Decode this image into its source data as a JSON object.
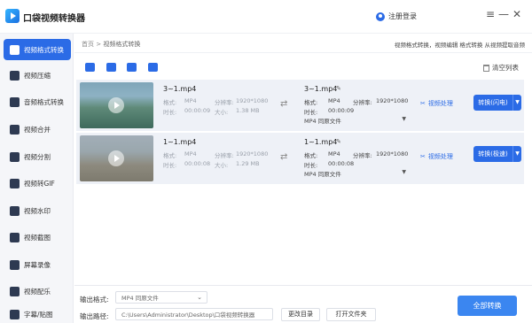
{
  "app": {
    "title": "口袋视频转换器",
    "login": "注册登录"
  },
  "window": {
    "menu_icon": "≡",
    "min_icon": "—",
    "close_icon": "✕"
  },
  "sidebar": {
    "items": [
      {
        "label": "视频格式转换",
        "icon": "format-convert-icon"
      },
      {
        "label": "视频压缩",
        "icon": "compress-icon"
      },
      {
        "label": "音频格式转换",
        "icon": "audio-convert-icon"
      },
      {
        "label": "视频合并",
        "icon": "merge-icon"
      },
      {
        "label": "视频分割",
        "icon": "split-icon"
      },
      {
        "label": "视频转GIF",
        "icon": "gif-icon"
      },
      {
        "label": "视频水印",
        "icon": "watermark-icon"
      },
      {
        "label": "视频截图",
        "icon": "screenshot-icon"
      },
      {
        "label": "屏幕录像",
        "icon": "screen-record-icon"
      },
      {
        "label": "视频配乐",
        "icon": "music-icon"
      },
      {
        "label": "字幕/贴图",
        "icon": "subtitle-icon"
      }
    ]
  },
  "breadcrumb": {
    "home": "首页",
    "sep": ">",
    "current": "视频格式转换"
  },
  "tips": "视频格式转换，视频编辑 格式转换 从视频提取音频",
  "toolbar": {
    "clear": "清空列表"
  },
  "files": [
    {
      "name": "3~1.mp4",
      "src": {
        "format_label": "格式:",
        "format": "MP4",
        "res_label": "分辨率:",
        "res": "1920*1080",
        "dur_label": "时长:",
        "dur": "00:00:09",
        "size_label": "大小:",
        "size": "1.38 MB"
      },
      "out_name": "3~1.mp4",
      "out": {
        "format_label": "格式:",
        "format": "MP4",
        "res_label": "分辨率:",
        "res": "1920*1080",
        "dur_label": "时长:",
        "dur": "00:00:09"
      },
      "out_select": "MP4   同原文件",
      "process": "视频处理",
      "convert": "转换(闪电)"
    },
    {
      "name": "1~1.mp4",
      "src": {
        "format_label": "格式:",
        "format": "MP4",
        "res_label": "分辨率:",
        "res": "1920*1080",
        "dur_label": "时长:",
        "dur": "00:00:08",
        "size_label": "大小:",
        "size": "1.29 MB"
      },
      "out_name": "1~1.mp4",
      "out": {
        "format_label": "格式:",
        "format": "MP4",
        "res_label": "分辨率:",
        "res": "1920*1080",
        "dur_label": "时长:",
        "dur": "00:00:08"
      },
      "out_select": "MP4   同原文件",
      "process": "视频处理",
      "convert": "转换(极速)"
    }
  ],
  "footer": {
    "format_label": "输出格式:",
    "format_value": "MP4   同原文件",
    "path_label": "输出路径:",
    "path_value": "C:\\Users\\Administrator\\Desktop\\口袋视频转换器",
    "change_dir": "更改目录",
    "open_folder": "打开文件夹",
    "convert_all": "全部转换"
  },
  "colors": {
    "accent": "#2b6be6",
    "sidebar_bg": "#f5f6f9",
    "row_bg": "#eef1f7"
  }
}
